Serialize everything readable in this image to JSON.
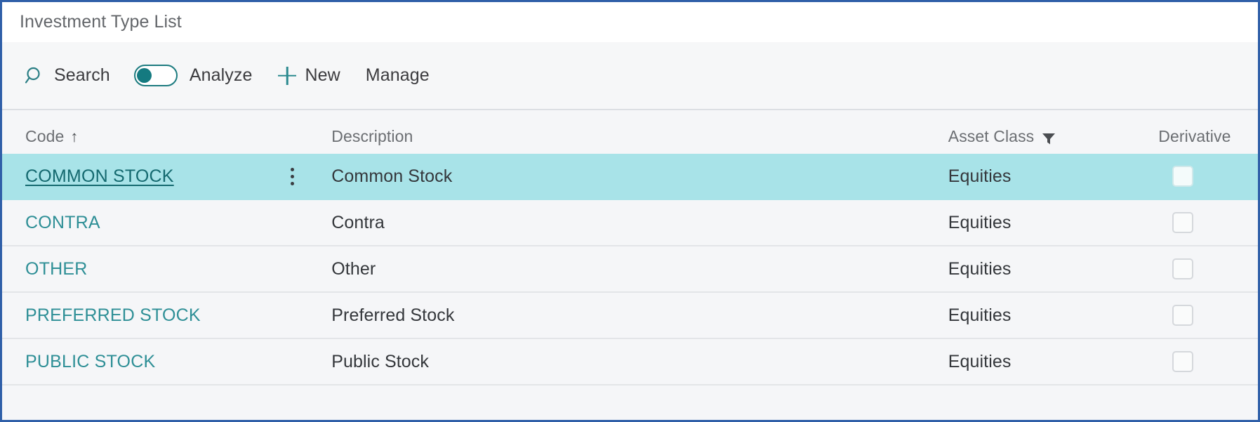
{
  "window": {
    "title": "Investment Type List"
  },
  "toolbar": {
    "search_label": "Search",
    "search_icon": "search-icon",
    "analyze_label": "Analyze",
    "analyze_toggle_state": "on",
    "new_label": "New",
    "new_icon": "plus-icon",
    "manage_label": "Manage"
  },
  "grid": {
    "columns": [
      {
        "key": "code",
        "label": "Code",
        "sort_indicator": "↑"
      },
      {
        "key": "description",
        "label": "Description"
      },
      {
        "key": "asset_class",
        "label": "Asset Class",
        "filter_icon": "filter-icon"
      },
      {
        "key": "derivative",
        "label": "Derivative"
      }
    ],
    "rows": [
      {
        "code": "COMMON STOCK",
        "description": "Common Stock",
        "asset_class": "Equities",
        "derivative": false,
        "selected": true,
        "row_menu_icon": "vertical-ellipsis-icon"
      },
      {
        "code": "CONTRA",
        "description": "Contra",
        "asset_class": "Equities",
        "derivative": false,
        "selected": false
      },
      {
        "code": "OTHER",
        "description": "Other",
        "asset_class": "Equities",
        "derivative": false,
        "selected": false
      },
      {
        "code": "PREFERRED STOCK",
        "description": "Preferred Stock",
        "asset_class": "Equities",
        "derivative": false,
        "selected": false
      },
      {
        "code": "PUBLIC STOCK",
        "description": "Public Stock",
        "asset_class": "Equities",
        "derivative": false,
        "selected": false
      }
    ]
  },
  "colors": {
    "accent_teal": "#2e8f96",
    "selected_row": "#a8e3e8",
    "link_teal": "#2e8f96",
    "selected_link": "#14696f",
    "toolbar_bg": "#f6f7f8",
    "grid_bg": "#f5f6f8",
    "window_border": "#2f5fa8",
    "title_text": "#63666a",
    "header_text": "#6b6e72"
  }
}
